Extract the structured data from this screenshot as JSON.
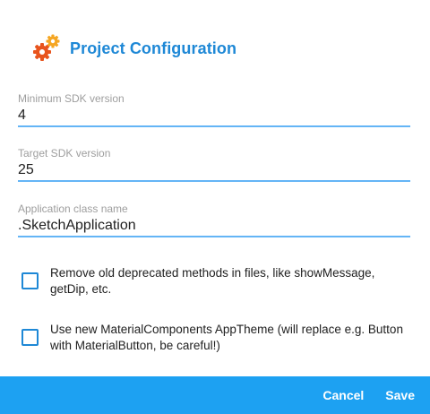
{
  "dialog": {
    "icon": "gears-icon",
    "title": "Project Configuration"
  },
  "fields": {
    "min_sdk": {
      "label": "Minimum SDK version",
      "value": "4"
    },
    "target_sdk": {
      "label": "Target SDK version",
      "value": "25"
    },
    "app_class": {
      "label": "Application class name",
      "value": ".SketchApplication"
    }
  },
  "checkboxes": [
    {
      "label": "Remove old deprecated methods in files, like showMessage, getDip, etc.",
      "checked": false
    },
    {
      "label": "Use new MaterialComponents AppTheme (will replace e.g. Button with MaterialButton, be careful!)",
      "checked": false
    }
  ],
  "actions": {
    "cancel": "Cancel",
    "save": "Save"
  },
  "colors": {
    "accent": "#1e88d6",
    "bar": "#1da1f2",
    "gear_orange": "#f5a623",
    "gear_red": "#e8541d"
  }
}
